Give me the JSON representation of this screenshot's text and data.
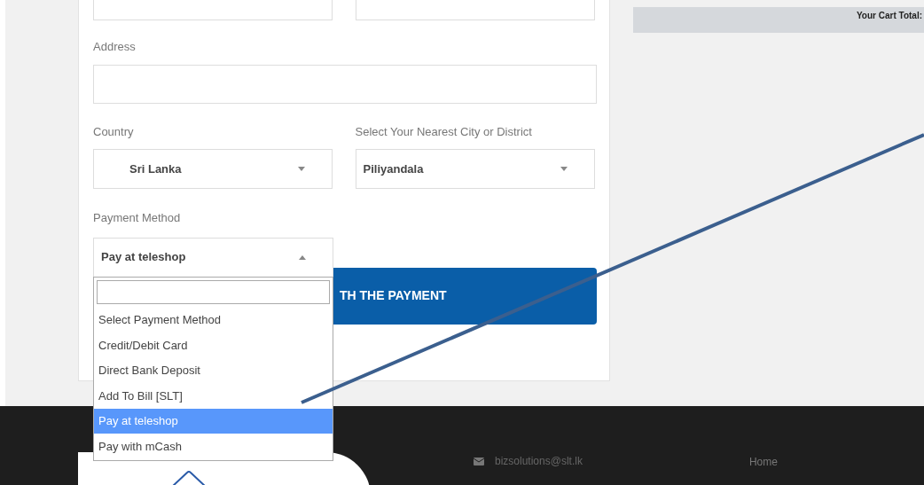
{
  "form": {
    "address": {
      "label": "Address"
    },
    "country": {
      "label": "Country",
      "value": "Sri Lanka"
    },
    "city": {
      "label": "Select Your Nearest City or District",
      "value": "Piliyandala"
    },
    "payment": {
      "label": "Payment Method",
      "value": "Pay at teleshop",
      "expanded": true,
      "options": [
        {
          "label": "Select Payment Method",
          "selected": false
        },
        {
          "label": "Credit/Debit Card",
          "selected": false
        },
        {
          "label": "Direct Bank Deposit",
          "selected": false
        },
        {
          "label": "Add To Bill [SLT]",
          "selected": false
        },
        {
          "label": "Pay at teleshop",
          "selected": true
        },
        {
          "label": "Pay with mCash",
          "selected": false
        }
      ]
    },
    "submit_button": {
      "label": "TH THE PAYMENT"
    }
  },
  "cart": {
    "label": "Your Cart Total:"
  },
  "footer": {
    "email": "bizsolutions@slt.lk",
    "links": [
      "Home"
    ]
  }
}
